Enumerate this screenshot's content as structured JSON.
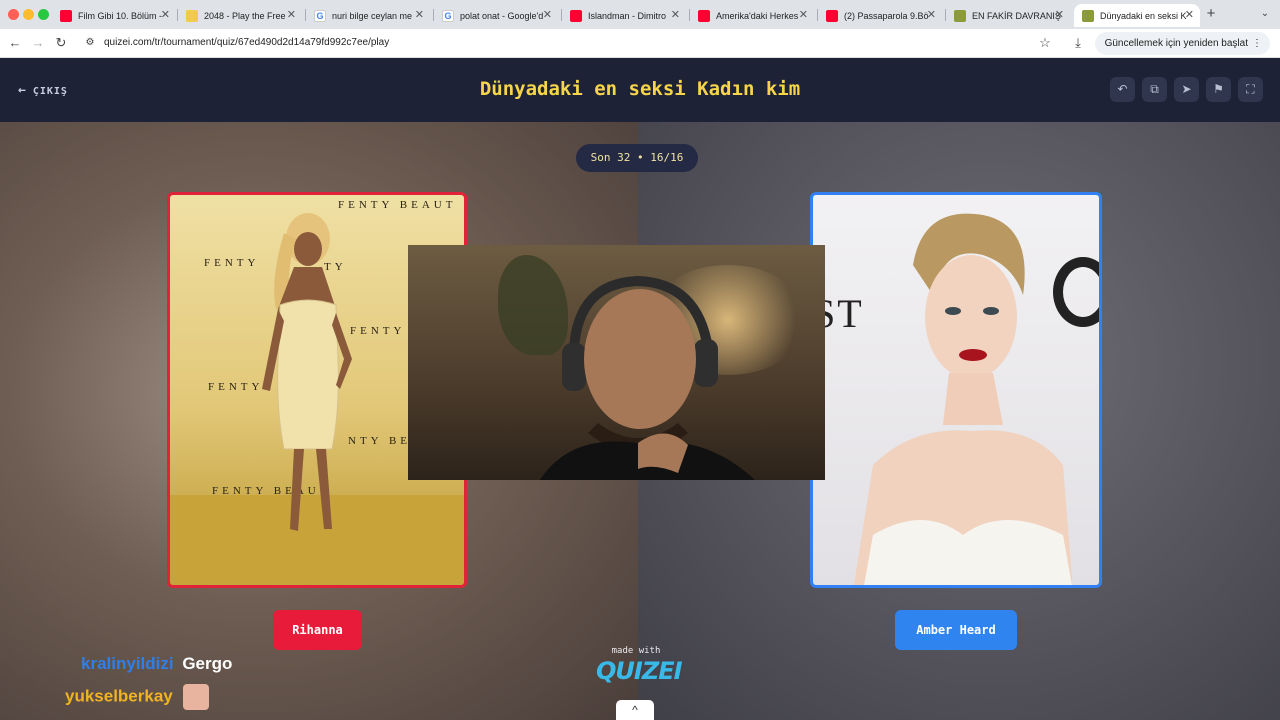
{
  "browser": {
    "tabs": [
      {
        "label": "Film Gibi 10. Bölüm -",
        "favicon_color": "#ff0033"
      },
      {
        "label": "2048 - Play the Free",
        "favicon_color": "#f2c94c"
      },
      {
        "label": "nuri bilge ceylan me",
        "favicon_color": "#4285f4"
      },
      {
        "label": "polat onat - Google'd",
        "favicon_color": "#4285f4"
      },
      {
        "label": "Islandman - Dimitro",
        "favicon_color": "#ff0033"
      },
      {
        "label": "Amerika'daki Herkes",
        "favicon_color": "#ff0033"
      },
      {
        "label": "(2) Passaparola 9.Bö",
        "favicon_color": "#ff0033"
      },
      {
        "label": "EN FAKİR DAVRANIŞ",
        "favicon_color": "#8c9b3a"
      },
      {
        "label": "Dünyadaki en seksi K",
        "favicon_color": "#8c9b3a"
      }
    ],
    "url": "quizei.com/tr/tournament/quiz/67ed490d2d14a79fd992c7ee/play",
    "update_label": "Güncellemek için yeniden başlat"
  },
  "header": {
    "exit_label": "ÇIKIŞ",
    "title": "Dünyadaki en seksi Kadın kim"
  },
  "round": {
    "label": "Son 32 • 16/16"
  },
  "choices": {
    "left": {
      "name": "Rihanna",
      "color": "#e81c3a"
    },
    "right": {
      "name": "Amber Heard",
      "color": "#2f84f0"
    }
  },
  "backdrop_text": {
    "fenty": "FENTY",
    "beauty": "FENTY BEAUT",
    "fenty_b": "FENTY B",
    "fenty_be": "NTY BE",
    "fenty_beau": "FENTY BEAU",
    "fenty_short": "FENTY",
    "ty": "TY",
    "st": "ST",
    "g": "G"
  },
  "chat": {
    "line1_user": "kralinyildizi",
    "line1_text": "Gergo",
    "line2_user": "yukselberkay"
  },
  "footer": {
    "made_with": "made with",
    "logo": "QUIZEI",
    "scroll_icon": "^"
  }
}
